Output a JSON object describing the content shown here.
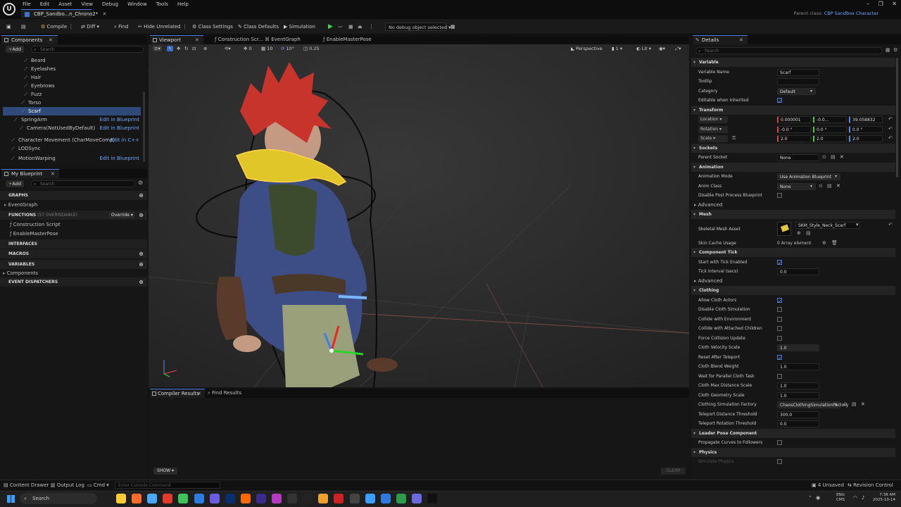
{
  "menu": [
    "File",
    "Edit",
    "Asset",
    "View",
    "Debug",
    "Window",
    "Tools",
    "Help"
  ],
  "doc_tab": "CBP_Sandbo...n_Chrono2*",
  "parent_class_label": "Parent class:",
  "parent_class_value": "CBP Sandbox Character",
  "toolbar": {
    "compile": "Compile",
    "diff": "Diff",
    "find": "Find",
    "hide_unrelated": "Hide Unrelated",
    "class_settings": "Class Settings",
    "class_defaults": "Class Defaults",
    "simulation": "Simulation",
    "debug_select": "No debug object selected"
  },
  "components": {
    "tab": "Components",
    "add": "Add",
    "search_placeholder": "Search",
    "items": [
      {
        "label": "Mustache",
        "indent": 40
      },
      {
        "label": "Beard",
        "indent": 40
      },
      {
        "label": "Eyelashes",
        "indent": 40
      },
      {
        "label": "Hair",
        "indent": 40
      },
      {
        "label": "Eyebrows",
        "indent": 40
      },
      {
        "label": "Fuzz",
        "indent": 40
      },
      {
        "label": "Torso",
        "indent": 36
      },
      {
        "label": "Scarf",
        "indent": 36,
        "selected": true
      },
      {
        "label": "SpringArm",
        "indent": 26,
        "link": "Edit in Blueprint"
      },
      {
        "label": "Camera(NotUsedByDefault)",
        "indent": 34,
        "link": "Edit in Blueprint"
      },
      {
        "label": "Character Movement (CharMoveComp)",
        "indent": 22,
        "link": "Edit in C++"
      },
      {
        "label": "LODSync",
        "indent": 22
      },
      {
        "label": "MotionWarping",
        "indent": 22,
        "link": "Edit in Blueprint"
      }
    ]
  },
  "blueprint": {
    "tab": "My Blueprint",
    "add": "Add",
    "search_placeholder": "Search",
    "graphs": "GRAPHS",
    "event_graph": "EventGraph",
    "functions": "FUNCTIONS",
    "functions_count": "(57 OVERRIDABLE)",
    "override": "Override",
    "construction": "Construction Script",
    "enable_master": "EnableMasterPose",
    "interfaces": "INTERFACES",
    "macros": "MACROS",
    "variables": "VARIABLES",
    "components_cat": "Components",
    "dispatchers": "EVENT DISPATCHERS"
  },
  "editor_tabs": [
    "Viewport",
    "Construction Scr...",
    "EventGraph",
    "EnableMasterPose"
  ],
  "viewport": {
    "snap_rot": "10°",
    "snap_grid": "10",
    "snap_scale": "0.25",
    "cam_speed": "1",
    "perspective": "Perspective",
    "lit": "Lit",
    "zero": "0"
  },
  "bottom": {
    "compiler_tab": "Compiler Results",
    "find_tab": "Find Results",
    "show": "SHOW",
    "clear": "CLEAR"
  },
  "status": {
    "content_drawer": "Content Drawer",
    "output_log": "Output Log",
    "cmd": "Cmd",
    "console_placeholder": "Enter Console Command",
    "unsaved": "4 Unsaved",
    "revision": "Revision Control"
  },
  "details": {
    "tab": "Details",
    "search_placeholder": "Search",
    "rows": [
      {
        "type": "h",
        "label": "Variable"
      },
      {
        "label": "Variable Name",
        "value": "Scarf"
      },
      {
        "label": "Tooltip",
        "value": ""
      },
      {
        "label": "Category",
        "value": "Default",
        "dd": true
      },
      {
        "label": "Editable when Inherited",
        "check": true
      },
      {
        "type": "h",
        "label": "Transform"
      },
      {
        "label": "Location",
        "dd_label": true,
        "vec": [
          "0.000001",
          "-0.0...",
          "39.058832"
        ]
      },
      {
        "label": "Rotation",
        "dd_label": true,
        "vec": [
          "-0.0 °",
          "0.0 °",
          "0.0 °"
        ]
      },
      {
        "label": "Scale",
        "dd_label": true,
        "vec": [
          "2.0",
          "2.0",
          "2.0"
        ]
      },
      {
        "type": "h",
        "label": "Sockets"
      },
      {
        "label": "Parent Socket",
        "value": "None",
        "icons": true
      },
      {
        "type": "h",
        "label": "Animation"
      },
      {
        "label": "Animation Mode",
        "value": "Use Animation Blueprint",
        "dd": true
      },
      {
        "label": "Anim Class",
        "value": "None",
        "dd": true,
        "icons": true
      },
      {
        "label": "Disable Post Process Blueprint",
        "check": false
      },
      {
        "type": "s",
        "label": "Advanced"
      },
      {
        "type": "h",
        "label": "Mesh"
      },
      {
        "label": "Skeletal Mesh Asset",
        "value": "SKM_Style_Neck_Scarf",
        "asset": true
      },
      {
        "label": "Skin Cache Usage",
        "value": "0 Array element",
        "plain": true
      },
      {
        "type": "h",
        "label": "Component Tick"
      },
      {
        "label": "Start with Tick Enabled",
        "check": true
      },
      {
        "label": "Tick Interval (secs)",
        "value": "0.0"
      },
      {
        "type": "s",
        "label": "Advanced"
      },
      {
        "type": "h",
        "label": "Clothing"
      },
      {
        "label": "Allow Cloth Actors",
        "check": true
      },
      {
        "label": "Disable Cloth Simulation",
        "check": false
      },
      {
        "label": "Collide with Environment",
        "check": false
      },
      {
        "label": "Collide with Attached Children",
        "check": false
      },
      {
        "label": "Force Collision Update",
        "check": false
      },
      {
        "label": "Cloth Velocity Scale",
        "value": "1.0"
      },
      {
        "label": "Reset After Teleport",
        "check": true
      },
      {
        "label": "Cloth Blend Weight",
        "value": "1.0"
      },
      {
        "label": "Wait for Parallel Cloth Task",
        "check": false
      },
      {
        "label": "Cloth Max Distance Scale",
        "value": "1.0"
      },
      {
        "label": "Cloth Geometry Scale",
        "value": "1.0"
      },
      {
        "label": "Clothing Simulation Factory",
        "value": "ChaosClothingSimulationFactory",
        "dd": true,
        "icons": true
      },
      {
        "label": "Teleport Distance Threshold",
        "value": "300.0"
      },
      {
        "label": "Teleport Rotation Threshold",
        "value": "0.0"
      },
      {
        "type": "h",
        "label": "Leader Pose Component"
      },
      {
        "label": "Propagate Curves to Followers",
        "check": false
      },
      {
        "type": "h",
        "label": "Physics"
      },
      {
        "label": "Simulate Physics",
        "check": false,
        "dim": true
      }
    ]
  },
  "taskbar": {
    "search": "Search",
    "lang": "ENG",
    "lang2": "CMS",
    "time": "7:38 AM",
    "date": "2025-10-14"
  },
  "accent": "#4a7ae0"
}
